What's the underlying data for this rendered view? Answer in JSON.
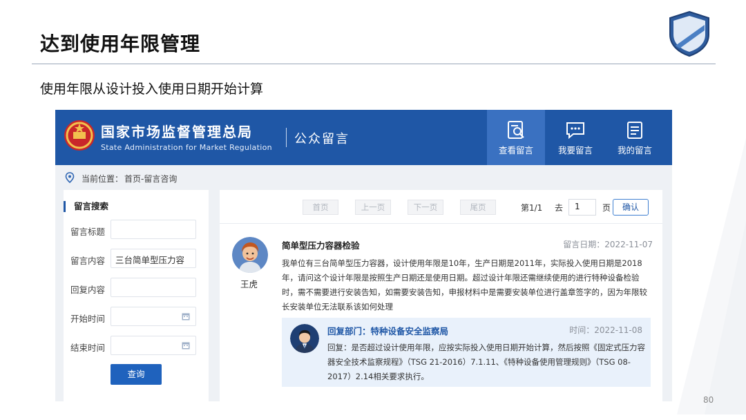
{
  "slide": {
    "title": "达到使用年限管理",
    "subtitle": "使用年限从设计投入使用日期开始计算",
    "page_number": "80"
  },
  "site": {
    "org_name": "国家市场监督管理总局",
    "org_name_en": "State Administration for Market Regulation",
    "section": "公众留言",
    "nav": [
      {
        "label": "查看留言",
        "icon": "search-document-icon",
        "active": true
      },
      {
        "label": "我要留言",
        "icon": "chat-bubble-icon",
        "active": false
      },
      {
        "label": "我的留言",
        "icon": "list-document-icon",
        "active": false
      }
    ],
    "breadcrumb": {
      "prefix": "当前位置：",
      "path": "首页-留言咨询"
    }
  },
  "search": {
    "title": "留言搜索",
    "fields": [
      {
        "label": "留言标题",
        "value": ""
      },
      {
        "label": "留言内容",
        "value": "三台简单型压力容"
      },
      {
        "label": "回复内容",
        "value": ""
      },
      {
        "label": "开始时间",
        "value": ""
      },
      {
        "label": "结束时间",
        "value": ""
      }
    ],
    "button": "查询"
  },
  "pager": {
    "first": "首页",
    "prev": "上一页",
    "next": "下一页",
    "last": "尾页",
    "page_info": "第1/1",
    "go_label": "去",
    "page_value": "1",
    "page_unit": "页",
    "confirm": "确认"
  },
  "message": {
    "asker": "王虎",
    "title": "简单型压力容器检验",
    "date": "留言日期：2022-11-07",
    "body": "我单位有三台简单型压力容器，设计使用年限是10年，生产日期是2011年，实际投入使用日期是2018年，请问这个设计年限是按照生产日期还是使用日期。超过设计年限还需继续使用的进行特种设备检验时，需不需要进行安装告知，如需要安装告知，申报材料中是需要安装单位进行盖章签字的，因为年限较长安装单位无法联系该如何处理",
    "reply_dept": "回复部门：特种设备安全监察局",
    "reply_date": "时间：2022-11-08",
    "reply_body": "回复：是否超过设计使用年限，应按实际投入使用日期开始计算，然后按照《固定式压力容器安全技术监察规程》（TSG 21-2016）7.1.11、《特种设备使用管理规则》（TSG 08-2017）2.14相关要求执行。"
  },
  "colors": {
    "header_blue": "#1f57a6",
    "nav_active": "#3a71c1",
    "button_blue": "#1f62bd",
    "reply_bg": "#e9f1fb"
  }
}
